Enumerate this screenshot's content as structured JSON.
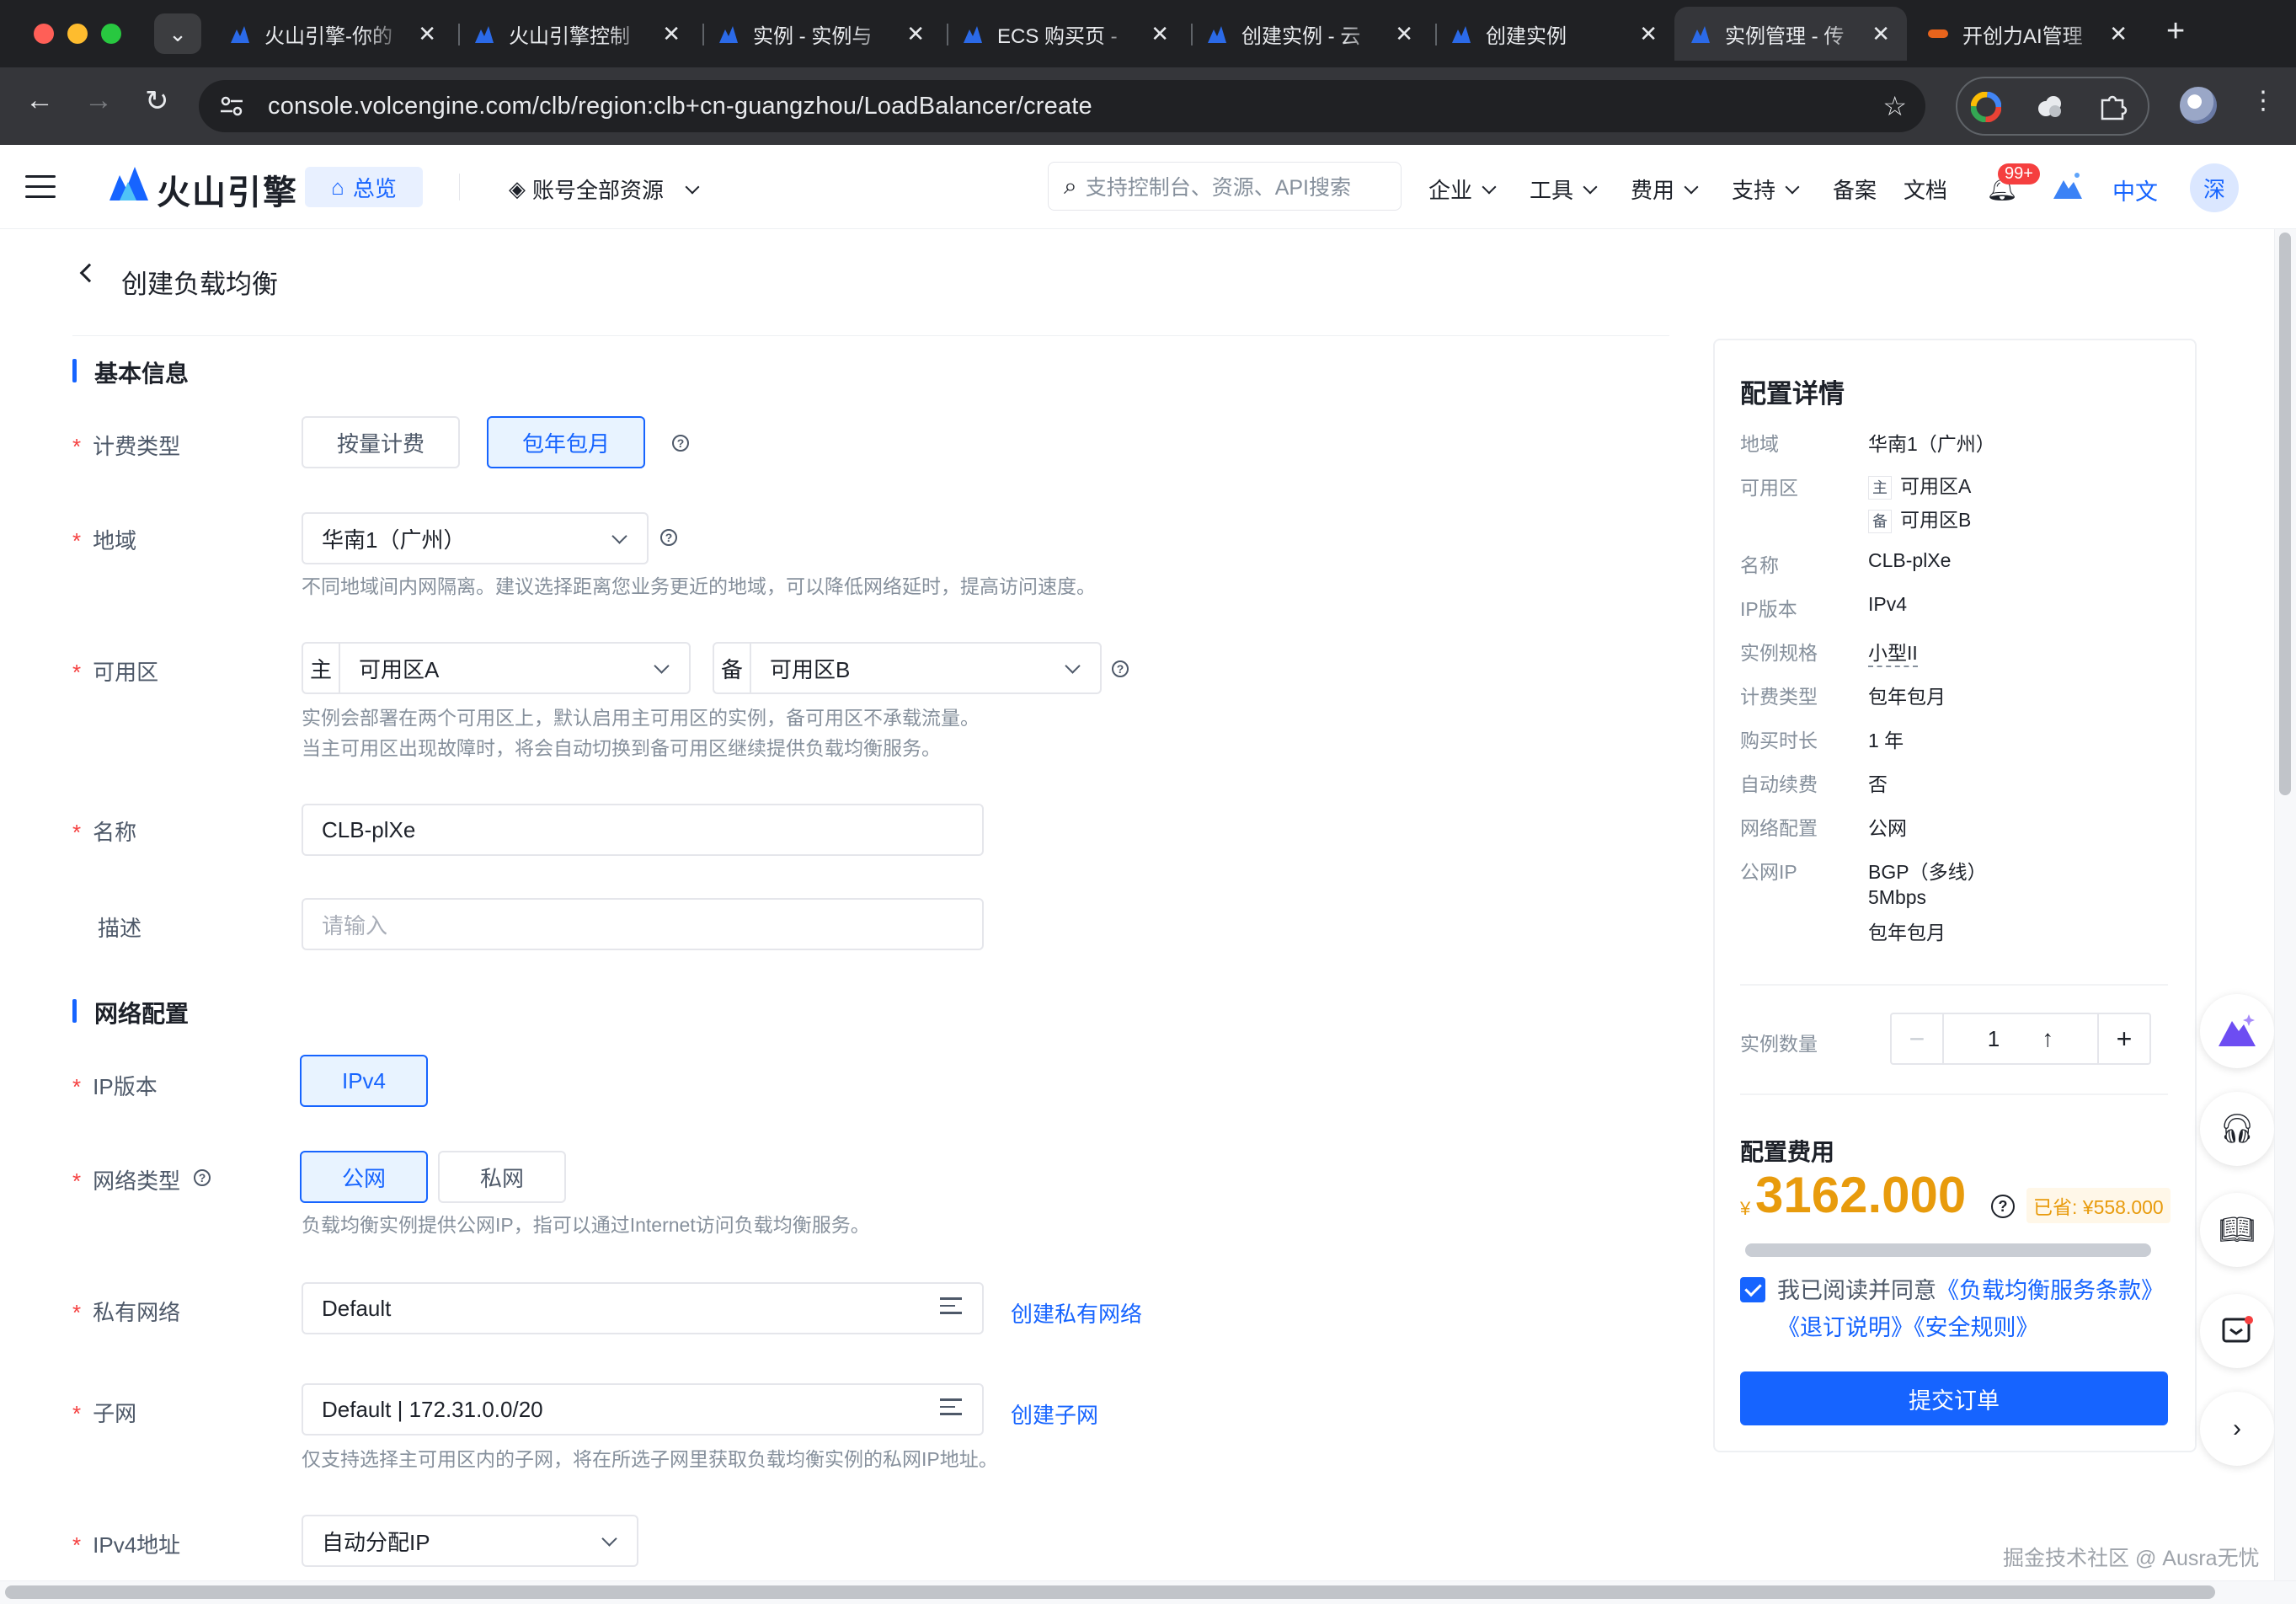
{
  "browser": {
    "tabs": [
      {
        "title": "火山引擎-你的"
      },
      {
        "title": "火山引擎控制"
      },
      {
        "title": "实例 - 实例与"
      },
      {
        "title": "ECS 购买页 -"
      },
      {
        "title": "创建实例 - 云"
      },
      {
        "title": "创建实例"
      },
      {
        "title": "实例管理 - 传"
      },
      {
        "title": "开创力AI管理"
      }
    ],
    "url": "console.volcengine.com/clb/region:clb+cn-guangzhou/LoadBalancer/create"
  },
  "header": {
    "logo": "火山引擎",
    "home": "总览",
    "resources": "账号全部资源",
    "search_placeholder": "支持控制台、资源、API搜索",
    "menus": [
      "企业",
      "工具",
      "费用",
      "支持",
      "备案",
      "文档"
    ],
    "badge": "99+",
    "lang": "中文",
    "user": "深"
  },
  "page": {
    "title": "创建负载均衡",
    "basic": {
      "section": "基本信息",
      "billing_label": "计费类型",
      "billing_options": [
        "按量计费",
        "包年包月"
      ],
      "region_label": "地域",
      "region_value": "华南1（广州）",
      "region_hint": "不同地域间内网隔离。建议选择距离您业务更近的地域，可以降低网络延时，提高访问速度。",
      "zone_label": "可用区",
      "zone_primary_prefix": "主",
      "zone_primary": "可用区A",
      "zone_backup_prefix": "备",
      "zone_backup": "可用区B",
      "zone_hint_1": "实例会部署在两个可用区上，默认启用主可用区的实例，备可用区不承载流量。",
      "zone_hint_2": "当主可用区出现故障时，将会自动切换到备可用区继续提供负载均衡服务。",
      "name_label": "名称",
      "name_value": "CLB-plXe",
      "desc_label": "描述",
      "desc_placeholder": "请输入"
    },
    "network": {
      "section": "网络配置",
      "ip_label": "IP版本",
      "ip_value": "IPv4",
      "type_label": "网络类型",
      "type_options": [
        "公网",
        "私网"
      ],
      "type_hint": "负载均衡实例提供公网IP，指可以通过Internet访问负载均衡服务。",
      "vpc_label": "私有网络",
      "vpc_value": "Default",
      "vpc_link": "创建私有网络",
      "subnet_label": "子网",
      "subnet_value": "Default | 172.31.0.0/20",
      "subnet_link": "创建子网",
      "subnet_hint": "仅支持选择主可用区内的子网，将在所选子网里获取负载均衡实例的私网IP地址。",
      "ipv4_label": "IPv4地址",
      "ipv4_value": "自动分配IP"
    }
  },
  "summary": {
    "title": "配置详情",
    "rows": {
      "region_k": "地域",
      "region_v": "华南1（广州）",
      "zone_k": "可用区",
      "zone_main_tag": "主",
      "zone_main_v": "可用区A",
      "zone_bak_tag": "备",
      "zone_bak_v": "可用区B",
      "name_k": "名称",
      "name_v": "CLB-plXe",
      "ip_k": "IP版本",
      "ip_v": "IPv4",
      "spec_k": "实例规格",
      "spec_v": "小型II",
      "billing_k": "计费类型",
      "billing_v": "包年包月",
      "duration_k": "购买时长",
      "duration_v": "1 年",
      "renew_k": "自动续费",
      "renew_v": "否",
      "net_k": "网络配置",
      "net_v": "公网",
      "pubip_k": "公网IP",
      "pubip_v1": "BGP（多线）",
      "pubip_v2": "5Mbps",
      "pubip_v3": "包年包月"
    },
    "qty_label": "实例数量",
    "qty_value": "1",
    "cost_title": "配置费用",
    "currency": "¥",
    "price": "3162.000",
    "saved": "已省: ¥558.000",
    "agree_prefix": "我已阅读并同意",
    "agree_links": "《负载均衡服务条款》《退订说明》《安全规则》",
    "submit": "提交订单"
  },
  "watermark": "掘金技术社区 @ Ausra无忧",
  "colors": {
    "primary": "#1664ff",
    "price": "#e89b0c",
    "required": "#f53f3f"
  }
}
